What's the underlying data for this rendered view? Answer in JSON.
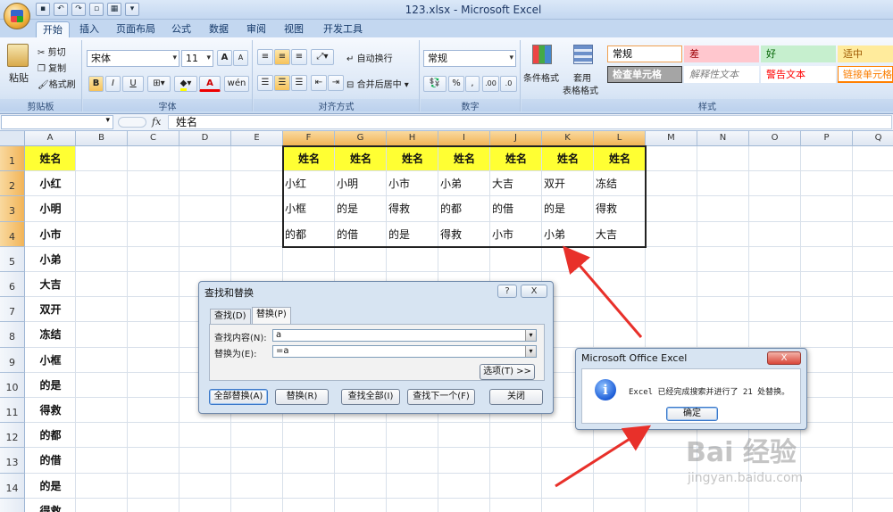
{
  "window": {
    "title": "123.xlsx - Microsoft Excel"
  },
  "ribbon_tabs": [
    "开始",
    "插入",
    "页面布局",
    "公式",
    "数据",
    "审阅",
    "视图",
    "开发工具"
  ],
  "ribbon": {
    "clipboard": {
      "paste": "粘贴",
      "cut": "剪切",
      "copy": "复制",
      "format_painter": "格式刷",
      "label": "剪贴板"
    },
    "font": {
      "name": "宋体",
      "size": "11",
      "grow": "A",
      "shrink": "A",
      "bold": "B",
      "italic": "I",
      "underline": "U",
      "color_a": "A",
      "phonetic": "wén",
      "label": "字体"
    },
    "alignment": {
      "wrap": "自动换行",
      "merge": "合并后居中",
      "label": "对齐方式"
    },
    "number": {
      "format": "常规",
      "percent": "%",
      "comma": ",",
      "inc": ".00",
      "dec": ".0",
      "label": "数字"
    },
    "styles": {
      "conditional": "条件格式",
      "table_line1": "套用",
      "table_line2": "表格格式",
      "cells": [
        {
          "text": "常规",
          "color": "#000000",
          "bg": "#ffffff",
          "border": "#f0a050"
        },
        {
          "text": "差",
          "color": "#9c0006",
          "bg": "#ffc7ce",
          "border": "#ffc7ce"
        },
        {
          "text": "好",
          "color": "#006100",
          "bg": "#c6efce",
          "border": "#c6efce"
        },
        {
          "text": "适中",
          "color": "#9c5700",
          "bg": "#ffeb9c",
          "border": "#ffeb9c"
        },
        {
          "text": "检查单元格",
          "color": "#ffffff",
          "bg": "#a5a5a5",
          "border": "#3f3f3f"
        },
        {
          "text": "解释性文本",
          "color": "#7f7f7f",
          "bg": "#ffffff",
          "border": "#ffffff"
        },
        {
          "text": "警告文本",
          "color": "#ff0000",
          "bg": "#ffffff",
          "border": "#ffffff"
        },
        {
          "text": "链接单元格",
          "color": "#fa7d00",
          "bg": "#ffffff",
          "border": "#ff8001"
        }
      ],
      "label": "样式"
    }
  },
  "formula_bar": {
    "fx": "fx",
    "value": "姓名"
  },
  "columns": [
    "A",
    "B",
    "C",
    "D",
    "E",
    "F",
    "G",
    "H",
    "I",
    "J",
    "K",
    "L",
    "M",
    "N",
    "O",
    "P",
    "Q"
  ],
  "rows": [
    "1",
    "2",
    "3",
    "4",
    "5",
    "6",
    "7",
    "8",
    "9",
    "10",
    "11",
    "12",
    "13",
    "14"
  ],
  "column_a": [
    "姓名",
    "小红",
    "小明",
    "小市",
    "小弟",
    "大吉",
    "双开",
    "冻结",
    "小框",
    "的是",
    "得救",
    "的都",
    "的借",
    "的是",
    "得救"
  ],
  "table_rows": [
    [
      "姓名",
      "姓名",
      "姓名",
      "姓名",
      "姓名",
      "姓名",
      "姓名"
    ],
    [
      "小红",
      "小明",
      "小市",
      "小弟",
      "大吉",
      "双开",
      "冻结"
    ],
    [
      "小框",
      "的是",
      "得救",
      "的都",
      "的借",
      "的是",
      "得救"
    ],
    [
      "的都",
      "的借",
      "的是",
      "得救",
      "小市",
      "小弟",
      "大吉"
    ]
  ],
  "find_dialog": {
    "title": "查找和替换",
    "help": "?",
    "close": "X",
    "tab_find": "查找(D)",
    "tab_replace": "替换(P)",
    "find_label": "查找内容(N):",
    "find_value": "a",
    "replace_label": "替换为(E):",
    "replace_value": "=a",
    "options": "选项(T) >>",
    "btn_replace_all": "全部替换(A)",
    "btn_replace": "替换(R)",
    "btn_find_all": "查找全部(I)",
    "btn_find_next": "查找下一个(F)",
    "btn_close": "关闭"
  },
  "message_box": {
    "title": "Microsoft Office Excel",
    "close": "X",
    "icon": "i",
    "message": "Excel 已经完成搜索并进行了 21 处替换。",
    "ok": "确定"
  },
  "watermark": {
    "logo": "Bai 经验",
    "url": "jingyan.baidu.com"
  },
  "colors": {
    "highlight_yellow": "#ffff33",
    "arrow_red": "#e8302a"
  }
}
